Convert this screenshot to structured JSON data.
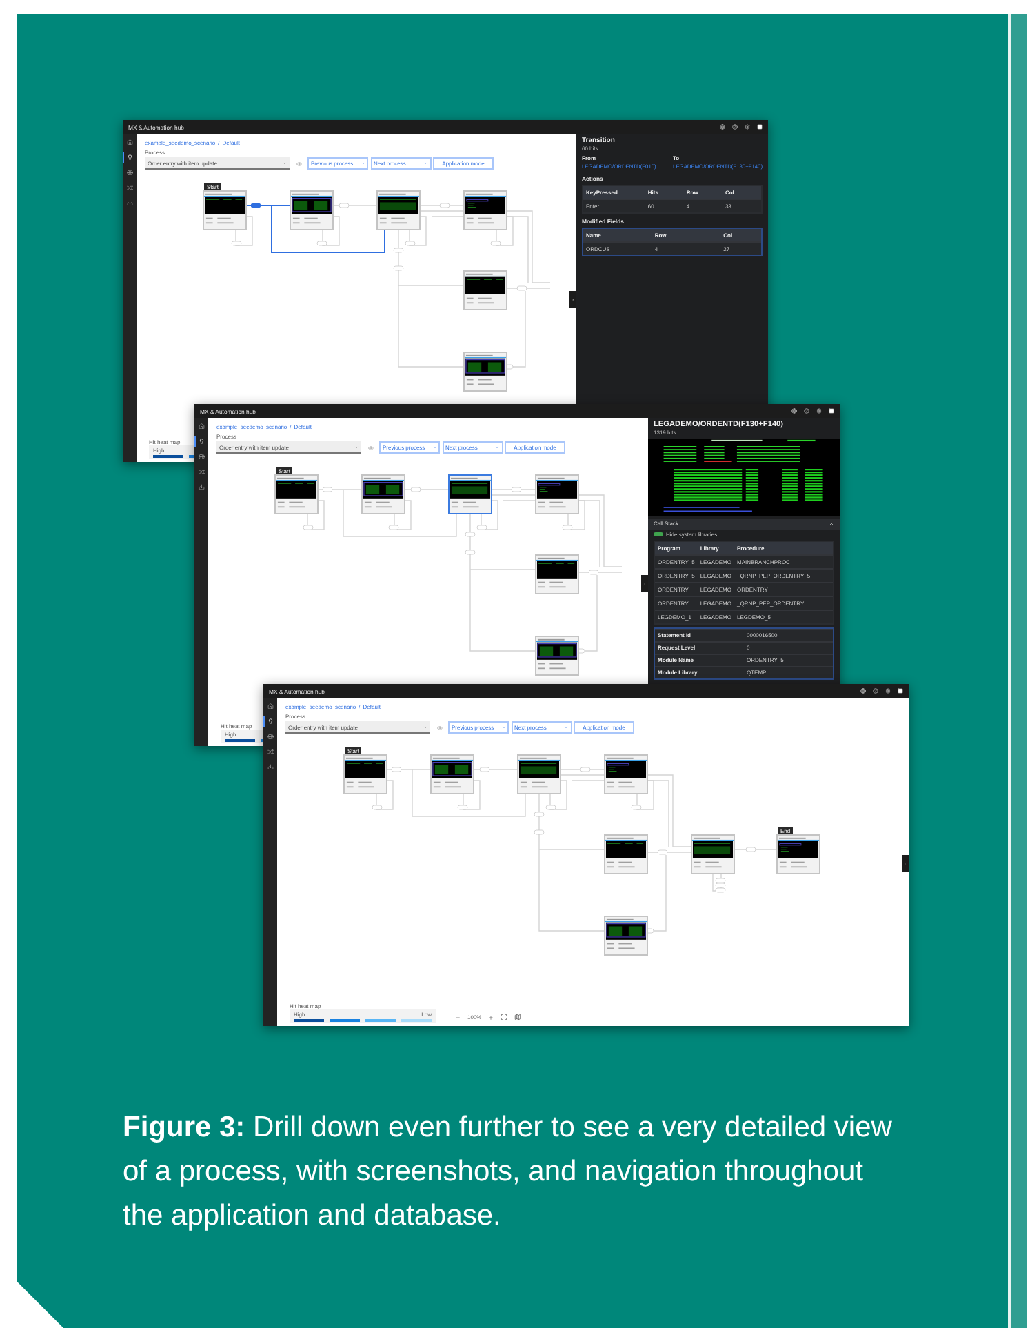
{
  "windows": [
    {
      "title": "MX & Automation hub",
      "sidebar": [
        {
          "kind": "home",
          "selected": false
        },
        {
          "kind": "bulb",
          "selected": true
        },
        {
          "kind": "globe",
          "selected": false
        },
        {
          "kind": "tools",
          "selected": false
        },
        {
          "kind": "download",
          "selected": false
        }
      ],
      "breadcrumb": {
        "path": "example_seedemo_scenario",
        "separator": "/",
        "current": "Default"
      },
      "process": {
        "label": "Process",
        "value": "Order entry with item update"
      },
      "buttons": [
        {
          "label": "Previous process",
          "kind": "dropdown"
        },
        {
          "label": "Next process",
          "kind": "dropdown"
        },
        {
          "label": "Application mode",
          "kind": "plain"
        }
      ],
      "diagram": {
        "nodes": [
          {
            "badge": "Start",
            "selected": false
          },
          {
            "selected": false
          },
          {
            "selected": false
          },
          {
            "selected": false
          },
          {
            "selected": false
          },
          {
            "selected": false
          }
        ],
        "edges": [
          {
            "selected": true
          },
          {
            "selected": false
          },
          {
            "selected": false
          },
          {
            "selected": false
          },
          {
            "selected": false
          },
          {
            "selected": false
          },
          {
            "selected": false
          },
          {
            "selected": true
          },
          {
            "selected": false
          },
          {
            "selected": false
          },
          {
            "selected": false
          },
          {
            "selected": false
          }
        ]
      },
      "heat_map": {
        "label": "Hit heat map",
        "high": "High"
      },
      "panel": {
        "kind": "transition",
        "title": "Transition",
        "hits": "60 hits",
        "from_label": "From",
        "from": "LEGADEMO/ORDENTD(F010)",
        "to_label": "To",
        "to": "LEGADEMO/ORDENTD(F130+F140)",
        "sections": [
          {
            "title": "Actions",
            "columns": [
              "KeyPressed",
              "Hits",
              "Row",
              "Col"
            ],
            "rows": [
              [
                "Enter",
                "60",
                "4",
                "33"
              ]
            ]
          },
          {
            "title": "Modified Fields",
            "columns": [
              "Name",
              "Row",
              "Col"
            ],
            "rows": [
              [
                "ORDCUS",
                "4",
                "27"
              ]
            ]
          }
        ]
      }
    },
    {
      "title": "MX & Automation hub",
      "sidebar": [
        {
          "kind": "home",
          "selected": false
        },
        {
          "kind": "bulb",
          "selected": true
        },
        {
          "kind": "globe",
          "selected": false
        },
        {
          "kind": "tools",
          "selected": false
        },
        {
          "kind": "download",
          "selected": false
        }
      ],
      "breadcrumb": {
        "path": "example_seedemo_scenario",
        "separator": "/",
        "current": "Default"
      },
      "process": {
        "label": "Process",
        "value": "Order entry with item update"
      },
      "buttons": [
        {
          "label": "Previous process",
          "kind": "dropdown"
        },
        {
          "label": "Next process",
          "kind": "dropdown"
        },
        {
          "label": "Application mode",
          "kind": "plain"
        }
      ],
      "diagram": {
        "nodes": [
          {
            "badge": "Start",
            "selected": false
          },
          {
            "selected": false
          },
          {
            "selected": true
          },
          {
            "selected": false
          },
          {
            "selected": false
          },
          {
            "selected": false
          }
        ],
        "edges": [
          {
            "selected": false
          },
          {
            "selected": false
          },
          {
            "selected": false
          },
          {
            "selected": false
          },
          {
            "selected": false
          },
          {
            "selected": false
          },
          {
            "selected": false
          },
          {
            "selected": false
          },
          {
            "selected": false
          },
          {
            "selected": false
          },
          {
            "selected": false
          },
          {
            "selected": false
          }
        ]
      },
      "heat_map": {
        "label": "Hit heat map",
        "high": "High"
      },
      "panel": {
        "kind": "screen",
        "title": "LEGADEMO/ORDENTD(F130+F140)",
        "hits": "1319 hits",
        "call_stack": {
          "title": "Call Stack",
          "toggle": {
            "label": "Hide system libraries",
            "on": true
          },
          "columns": [
            "Program",
            "Library",
            "Procedure"
          ],
          "rows": [
            [
              "ORDENTRY_5",
              "LEGADEMO",
              "MAINBRANCHPROC"
            ],
            [
              "ORDENTRY_5",
              "LEGADEMO",
              "_QRNP_PEP_ORDENTRY_5"
            ],
            [
              "ORDENTRY",
              "LEGADEMO",
              "ORDENTRY"
            ],
            [
              "ORDENTRY",
              "LEGADEMO",
              "_QRNP_PEP_ORDENTRY"
            ],
            [
              "LEGDEMO_1",
              "LEGADEMO",
              "LEGDEMO_5"
            ]
          ]
        },
        "details": [
          [
            "Statement Id",
            "0000016500"
          ],
          [
            "Request Level",
            "0"
          ],
          [
            "Module Name",
            "ORDENTRY_5"
          ],
          [
            "Module Library",
            "QTEMP"
          ]
        ]
      }
    },
    {
      "title": "MX & Automation hub",
      "sidebar": [
        {
          "kind": "home",
          "selected": false
        },
        {
          "kind": "bulb",
          "selected": true
        },
        {
          "kind": "globe",
          "selected": false
        },
        {
          "kind": "tools",
          "selected": false
        },
        {
          "kind": "download",
          "selected": false
        }
      ],
      "breadcrumb": {
        "path": "example_seedemo_scenario",
        "separator": "/",
        "current": "Default"
      },
      "process": {
        "label": "Process",
        "value": "Order entry with item update"
      },
      "buttons": [
        {
          "label": "Previous process",
          "kind": "dropdown"
        },
        {
          "label": "Next process",
          "kind": "dropdown"
        },
        {
          "label": "Application mode",
          "kind": "plain"
        }
      ],
      "diagram": {
        "nodes": [
          {
            "badge": "Start",
            "selected": false
          },
          {
            "selected": false
          },
          {
            "selected": false
          },
          {
            "selected": false
          },
          {
            "selected": false
          },
          {
            "selected": false
          },
          {
            "selected": false
          },
          {
            "badge": "End",
            "selected": false
          }
        ],
        "edges": [
          {
            "selected": false
          },
          {
            "selected": false
          },
          {
            "selected": false
          },
          {
            "selected": false
          },
          {
            "selected": false
          },
          {
            "selected": false
          },
          {
            "selected": false
          },
          {
            "selected": false
          },
          {
            "selected": false
          },
          {
            "selected": false
          },
          {
            "selected": false
          },
          {
            "selected": false
          },
          {
            "selected": false
          },
          {
            "selected": false
          }
        ]
      },
      "heat_map": {
        "label": "Hit heat map",
        "high": "High",
        "low": "Low"
      },
      "zoom": {
        "level": "100%"
      }
    }
  ],
  "caption": "**Figure 3:** Drill down even further to see a very detailed view of a process, with screenshots, and navigation throughout the application and database."
}
